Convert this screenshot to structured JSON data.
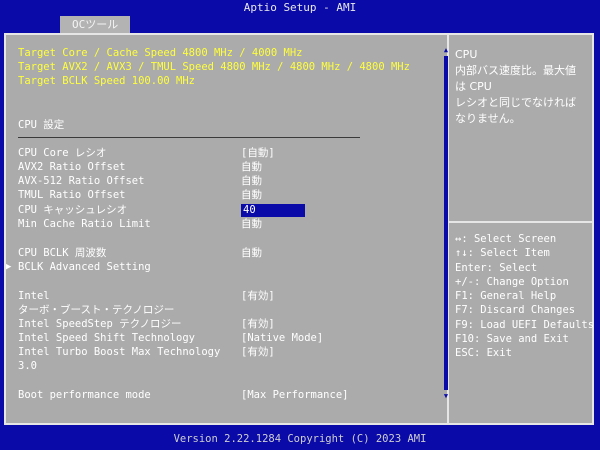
{
  "window": {
    "title": "Aptio Setup - AMI"
  },
  "tabs": [
    {
      "label": "OCツール"
    }
  ],
  "targets": [
    "Target Core / Cache Speed 4800 MHz / 4000 MHz",
    "Target AVX2 / AVX3 / TMUL Speed 4800 MHz / 4800 MHz / 4800 MHz",
    "Target BCLK  Speed 100.00 MHz"
  ],
  "section_title": "CPU 設定",
  "settings": [
    {
      "label": "CPU Core レシオ",
      "value": "[自動]"
    },
    {
      "label": "AVX2 Ratio Offset",
      "value": "自動"
    },
    {
      "label": "AVX-512 Ratio Offset",
      "value": "自動"
    },
    {
      "label": "TMUL Ratio Offset",
      "value": "自動"
    },
    {
      "label": "CPU  キャッシュレシオ",
      "value": "40"
    },
    {
      "label": "Min Cache  Ratio Limit",
      "value": "自動"
    },
    {
      "label": "CPU BCLK 周波数",
      "value": "自動"
    },
    {
      "label": "BCLK Advanced Setting",
      "value": ""
    },
    {
      "label": "Intel",
      "value": "[有効]"
    },
    {
      "label": "ターボ・ブースト・テクノロジー",
      "value": ""
    },
    {
      "label": "Intel SpeedStep テクノロジー",
      "value": "[有効]"
    },
    {
      "label": "Intel Speed Shift Technology",
      "value": "[Native Mode]"
    },
    {
      "label": "Intel Turbo Boost Max Technology",
      "value": "[有効]"
    },
    {
      "label": "3.0",
      "value": ""
    },
    {
      "label": "Boot performance mode",
      "value": "[Max Performance]"
    }
  ],
  "help": {
    "lines": [
      "CPU",
      "内部バス速度比。最大値",
      "は CPU",
      "レシオと同じでなければ",
      "なりません。"
    ]
  },
  "keys": [
    "↔: Select Screen",
    "↑↓: Select Item",
    "Enter: Select",
    "+/-: Change Option",
    "F1: General Help",
    "F7: Discard Changes",
    "F9: Load UEFI Defaults",
    "F10: Save and Exit",
    "ESC: Exit"
  ],
  "footer": "Version 2.22.1284 Copyright (C) 2023 AMI",
  "colors": {
    "background": "#0a0aa8",
    "panel": "#ababab",
    "target_text": "#ffff3c",
    "highlight": "#0a0aa8",
    "text": "#ffffff"
  },
  "icons": {
    "submenu": "triangle-right-icon",
    "scroll_up": "triangle-up-icon",
    "scroll_down": "triangle-down-icon"
  }
}
